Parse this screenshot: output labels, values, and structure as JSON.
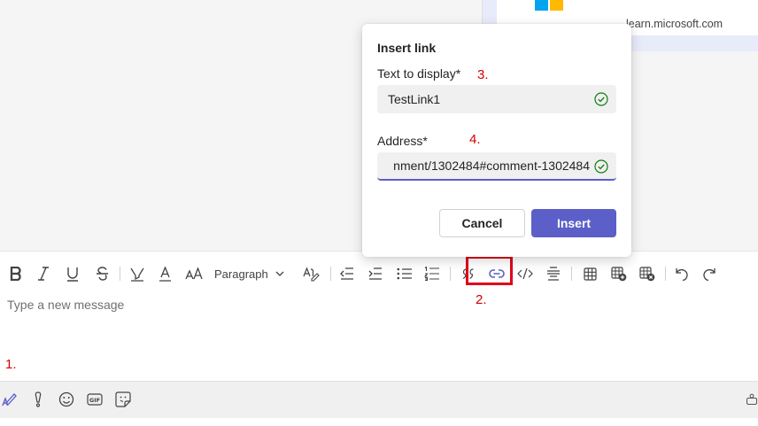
{
  "chat": {
    "link_card_domain": "learn.microsoft.com"
  },
  "dialog": {
    "title": "Insert link",
    "text_label": "Text to display*",
    "text_value": "TestLink1",
    "address_label": "Address*",
    "address_value": "nment/1302484#comment-1302484",
    "cancel_label": "Cancel",
    "insert_label": "Insert"
  },
  "toolbar": {
    "paragraph_label": "Paragraph",
    "icons": [
      "bold-icon",
      "italic-icon",
      "underline-icon",
      "strikethrough-icon",
      "highlight-icon",
      "font-color-icon",
      "font-size-icon",
      "format-style-icon",
      "decrease-indent-icon",
      "increase-indent-icon",
      "bulleted-list-icon",
      "numbered-list-icon",
      "quote-icon",
      "insert-link-icon",
      "code-snippet-icon",
      "horizontal-rule-icon",
      "insert-table-icon",
      "add-table-icon",
      "delete-table-icon",
      "undo-icon",
      "redo-icon"
    ]
  },
  "compose": {
    "placeholder": "Type a new message"
  },
  "annotations": {
    "a1": "1.",
    "a2": "2.",
    "a3": "3.",
    "a4": "4."
  },
  "colors": {
    "accent": "#5b5fc7",
    "annotation": "#e0001b",
    "valid_check": "#107c10"
  }
}
